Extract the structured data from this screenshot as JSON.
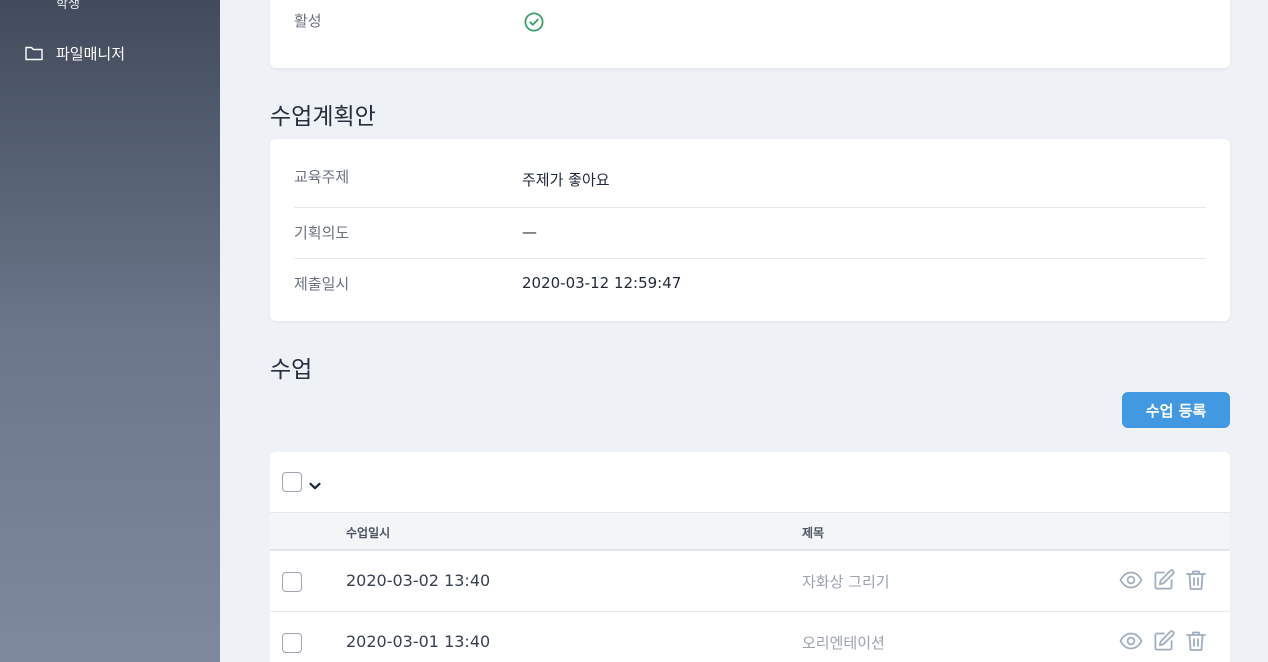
{
  "sidebar": {
    "sub_item_partial": "학생",
    "file_manager_label": "파일매니저"
  },
  "status_card": {
    "active_label": "활성",
    "active_value_icon": "check-circle-icon",
    "active_color": "#38a169"
  },
  "plan": {
    "section_title": "수업계획안",
    "fields": [
      {
        "label": "교육주제",
        "value": "주제가 좋아요"
      },
      {
        "label": "기획의도",
        "value": "—"
      },
      {
        "label": "제출일시",
        "value": "2020-03-12 12:59:47"
      }
    ]
  },
  "classes": {
    "section_title": "수업",
    "add_button_label": "수업 등록",
    "accent_color": "#4299e1",
    "columns": {
      "date": "수업일시",
      "title": "제목"
    },
    "rows": [
      {
        "date": "2020-03-02 13:40",
        "title": "자화상 그리기"
      },
      {
        "date": "2020-03-01 13:40",
        "title": "오리엔테이션"
      }
    ],
    "row_actions": [
      "eye-icon",
      "edit-icon",
      "trash-icon"
    ]
  }
}
